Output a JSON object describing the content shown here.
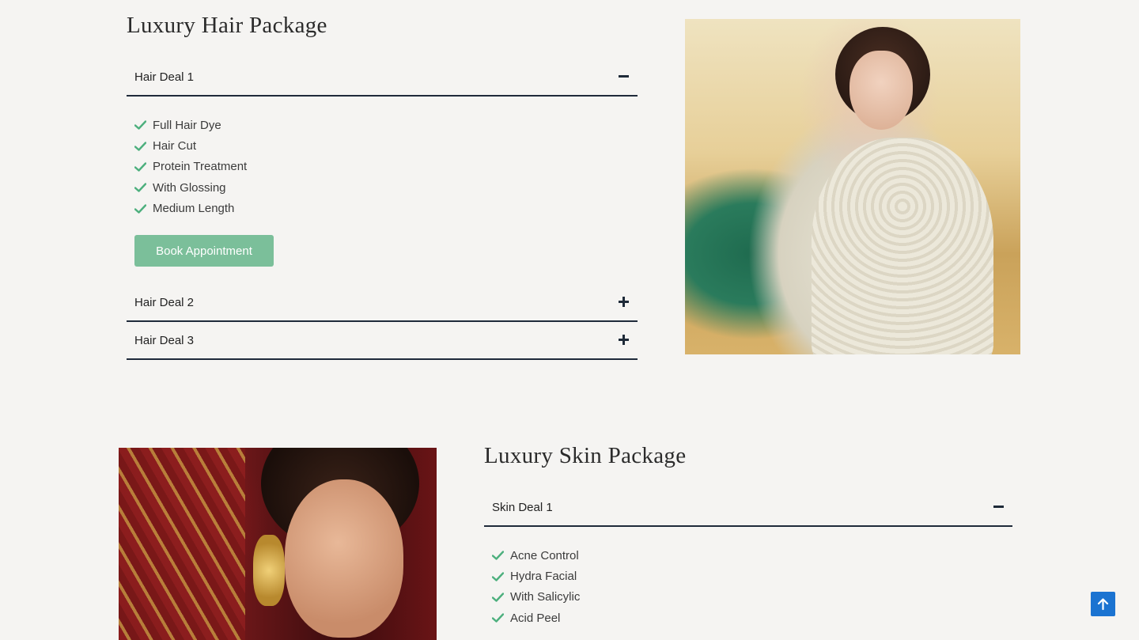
{
  "hair_package": {
    "title": "Luxury Hair Package",
    "deals": [
      {
        "label": "Hair Deal 1",
        "state": "expanded",
        "toggle_icon": "minus-icon"
      },
      {
        "label": "Hair Deal 2",
        "state": "collapsed",
        "toggle_icon": "plus-icon"
      },
      {
        "label": "Hair Deal 3",
        "state": "collapsed",
        "toggle_icon": "plus-icon"
      }
    ],
    "features": [
      "Full Hair Dye",
      "Hair Cut",
      "Protein Treatment",
      "With Glossing",
      "Medium Length"
    ],
    "book_button": "Book Appointment"
  },
  "skin_package": {
    "title": "Luxury Skin Package",
    "deals": [
      {
        "label": "Skin Deal 1",
        "state": "expanded",
        "toggle_icon": "minus-icon"
      }
    ],
    "features": [
      "Acne Control",
      "Hydra Facial",
      "With Salicylic",
      "Acid Peel"
    ]
  },
  "colors": {
    "accent_green": "#7bbf9a",
    "check_green": "#4caf7d",
    "divider_navy": "#1f2a3a",
    "scroll_top_blue": "#1b73d1",
    "page_bg": "#f5f4f2"
  },
  "icons": {
    "check": "check-icon",
    "scroll_top": "arrow-up-icon"
  }
}
